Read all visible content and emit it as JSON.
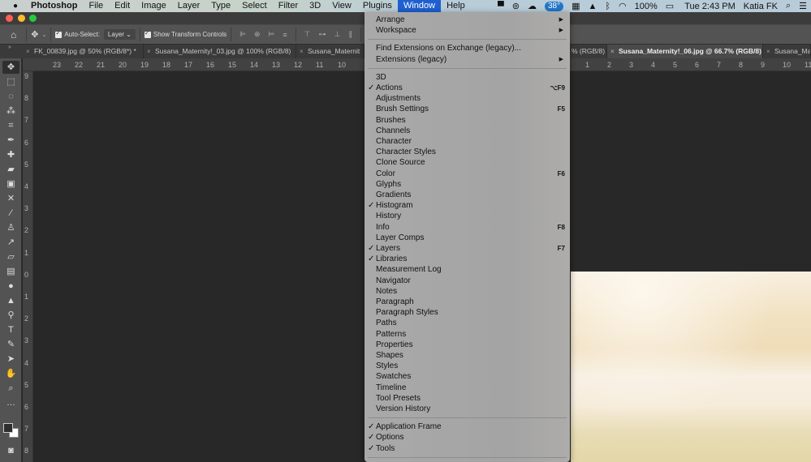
{
  "menubar": {
    "app_name": "Photoshop",
    "items": [
      "File",
      "Edit",
      "Image",
      "Layer",
      "Type",
      "Select",
      "Filter",
      "3D",
      "View",
      "Plugins",
      "Window",
      "Help"
    ],
    "active_item": "Window",
    "status": {
      "temperature": "38°",
      "battery": "100%",
      "clock": "Tue 2:43 PM",
      "user": "Katia FK"
    }
  },
  "options_bar": {
    "auto_select_label": "Auto-Select:",
    "auto_select_checked": true,
    "auto_select_value": "Layer",
    "show_transform_label": "Show Transform Controls",
    "show_transform_checked": true
  },
  "tabs": [
    {
      "label": "FK_00839.jpg @ 50% (RGB/8*) *",
      "active": false
    },
    {
      "label": "Susana_Maternity!_03.jpg @ 100% (RGB/8)",
      "active": false
    },
    {
      "label": "Susana_Maternit",
      "active": false
    },
    {
      "label": "% (RGB/8)",
      "active": false
    },
    {
      "label": "Susana_Maternity!_06.jpg @ 66.7% (RGB/8)",
      "active": true
    },
    {
      "label": "Susana_Ma",
      "active": false
    }
  ],
  "ruler_h_left": [
    "23",
    "22",
    "21",
    "20",
    "19",
    "18",
    "17",
    "16",
    "15",
    "14",
    "13",
    "12",
    "11",
    "10"
  ],
  "ruler_h_right": [
    "1",
    "2",
    "3",
    "4",
    "5",
    "6",
    "7",
    "8",
    "9",
    "10",
    "11"
  ],
  "ruler_v": [
    "9",
    "8",
    "7",
    "6",
    "5",
    "4",
    "3",
    "2",
    "1",
    "0",
    "1",
    "2",
    "3",
    "4",
    "5",
    "6",
    "7",
    "8"
  ],
  "tools": [
    "move-icon",
    "marquee-icon",
    "lasso-icon",
    "magic-wand-icon",
    "crop-icon",
    "eyedropper-icon",
    "spot-healing-icon",
    "brush-bandage-icon",
    "frame-icon",
    "content-aware-move-icon",
    "brush-icon",
    "clone-stamp-icon",
    "history-brush-icon",
    "eraser-icon",
    "gradient-icon",
    "blur-icon",
    "sharpen-icon",
    "dodge-icon",
    "type-icon",
    "pen-icon",
    "path-select-icon",
    "hand-rotate-icon",
    "zoom-icon",
    "more-icon"
  ],
  "window_menu": {
    "groups": [
      [
        {
          "label": "Arrange",
          "submenu": true
        },
        {
          "label": "Workspace",
          "submenu": true
        }
      ],
      [
        {
          "label": "Find Extensions on Exchange (legacy)..."
        },
        {
          "label": "Extensions (legacy)",
          "submenu": true
        }
      ],
      [
        {
          "label": "3D"
        },
        {
          "label": "Actions",
          "checked": true,
          "shortcut": "⌥F9"
        },
        {
          "label": "Adjustments"
        },
        {
          "label": "Brush Settings",
          "shortcut": "F5"
        },
        {
          "label": "Brushes"
        },
        {
          "label": "Channels"
        },
        {
          "label": "Character"
        },
        {
          "label": "Character Styles"
        },
        {
          "label": "Clone Source"
        },
        {
          "label": "Color",
          "shortcut": "F6"
        },
        {
          "label": "Glyphs"
        },
        {
          "label": "Gradients"
        },
        {
          "label": "Histogram",
          "checked": true
        },
        {
          "label": "History"
        },
        {
          "label": "Info",
          "shortcut": "F8"
        },
        {
          "label": "Layer Comps"
        },
        {
          "label": "Layers",
          "checked": true,
          "shortcut": "F7"
        },
        {
          "label": "Libraries",
          "checked": true
        },
        {
          "label": "Measurement Log"
        },
        {
          "label": "Navigator"
        },
        {
          "label": "Notes"
        },
        {
          "label": "Paragraph"
        },
        {
          "label": "Paragraph Styles"
        },
        {
          "label": "Paths"
        },
        {
          "label": "Patterns"
        },
        {
          "label": "Properties"
        },
        {
          "label": "Shapes"
        },
        {
          "label": "Styles"
        },
        {
          "label": "Swatches"
        },
        {
          "label": "Timeline"
        },
        {
          "label": "Tool Presets"
        },
        {
          "label": "Version History"
        }
      ],
      [
        {
          "label": "Application Frame",
          "checked": true
        },
        {
          "label": "Options",
          "checked": true
        },
        {
          "label": "Tools",
          "checked": true
        }
      ]
    ]
  },
  "colors": {
    "menu_highlight": "#1f5fd0",
    "traffic_close": "#fe5f57",
    "traffic_min": "#febc2e",
    "traffic_max": "#28c840"
  }
}
